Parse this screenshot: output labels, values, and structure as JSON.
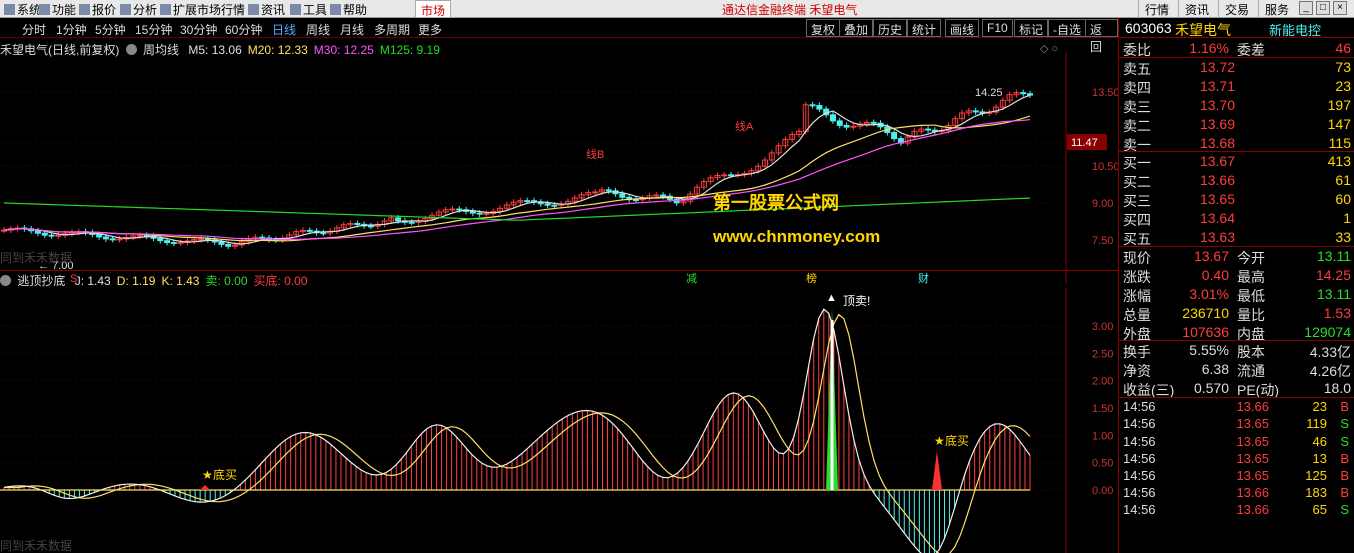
{
  "menu": {
    "items": [
      "系统",
      "功能",
      "报价",
      "分析",
      "扩展市场行情",
      "资讯",
      "工具",
      "帮助"
    ],
    "tab": "市场",
    "center_title": "通达信金融终端  禾望电气",
    "right_items": [
      "行情",
      "资讯",
      "交易",
      "服务"
    ]
  },
  "toolbar": {
    "periods": [
      "分时",
      "1分钟",
      "5分钟",
      "15分钟",
      "30分钟",
      "60分钟",
      "日线",
      "周线",
      "月线",
      "多周期",
      "更多"
    ],
    "active_period": "日线",
    "buttons": [
      "复权",
      "叠加",
      "历史",
      "统计",
      "画线",
      "F10",
      "标记",
      "-自选",
      "返回"
    ]
  },
  "main_chart": {
    "title": "禾望电气(日线,前复权)",
    "indicator_name": "周均线",
    "ma": [
      {
        "label": "M5: 13.06",
        "color": "#e0e0e0"
      },
      {
        "label": "M20: 12.33",
        "color": "#ffe066"
      },
      {
        "label": "M30: 12.25",
        "color": "#ff55ff"
      },
      {
        "label": "M125: 9.19",
        "color": "#22dd22"
      }
    ],
    "y_ticks": [
      "13.50",
      "11.47",
      "10.50",
      "9.00",
      "7.50"
    ],
    "current_price_box": "11.47",
    "high_label": "14.25",
    "low_label": "7.00",
    "annotations": [
      "线B",
      "线A"
    ],
    "event_markers": [
      "S",
      "减",
      "榜",
      "财"
    ],
    "watermark_left": "同到禾禾数据",
    "watermark_1": "第一股票公式网",
    "watermark_2": "www.chnmoney.com"
  },
  "sub_chart": {
    "name": "逃顶抄底",
    "values": [
      {
        "label": "J: 1.43",
        "color": "#e0e0e0"
      },
      {
        "label": "D: 1.19",
        "color": "#ffe066"
      },
      {
        "label": "K: 1.43",
        "color": "#ffe066"
      },
      {
        "label": "卖: 0.00",
        "color": "#2bdc2b"
      },
      {
        "label": "买底: 0.00",
        "color": "#ff3c3c"
      }
    ],
    "y_ticks": [
      "3.00",
      "2.50",
      "2.00",
      "1.50",
      "1.00",
      "0.50",
      "0.00"
    ],
    "signal_top": "顶卖!",
    "signal_bottom": "底买",
    "watermark": "同到禾禾数据"
  },
  "quote": {
    "code": "603063",
    "name": "禾望电气",
    "sector": "新能电控",
    "weibi_label": "委比",
    "weibi_value": "1.16%",
    "weicha_label": "委差",
    "weicha_value": "46",
    "asks": [
      {
        "label": "卖五",
        "price": "13.72",
        "vol": "73"
      },
      {
        "label": "卖四",
        "price": "13.71",
        "vol": "23"
      },
      {
        "label": "卖三",
        "price": "13.70",
        "vol": "197"
      },
      {
        "label": "卖二",
        "price": "13.69",
        "vol": "147"
      },
      {
        "label": "卖一",
        "price": "13.68",
        "vol": "115"
      }
    ],
    "bids": [
      {
        "label": "买一",
        "price": "13.67",
        "vol": "413"
      },
      {
        "label": "买二",
        "price": "13.66",
        "vol": "61"
      },
      {
        "label": "买三",
        "price": "13.65",
        "vol": "60"
      },
      {
        "label": "买四",
        "price": "13.64",
        "vol": "1"
      },
      {
        "label": "买五",
        "price": "13.63",
        "vol": "33"
      }
    ],
    "stats": [
      {
        "l1": "现价",
        "v1": "13.67",
        "c1": "red",
        "l2": "今开",
        "v2": "13.11",
        "c2": "green"
      },
      {
        "l1": "涨跌",
        "v1": "0.40",
        "c1": "red",
        "l2": "最高",
        "v2": "14.25",
        "c2": "red"
      },
      {
        "l1": "涨幅",
        "v1": "3.01%",
        "c1": "red",
        "l2": "最低",
        "v2": "13.11",
        "c2": "green"
      },
      {
        "l1": "总量",
        "v1": "236710",
        "c1": "yellow",
        "l2": "量比",
        "v2": "1.53",
        "c2": "red"
      },
      {
        "l1": "外盘",
        "v1": "107636",
        "c1": "red",
        "l2": "内盘",
        "v2": "129074",
        "c2": "green"
      }
    ],
    "stats2": [
      {
        "l1": "换手",
        "v1": "5.55%",
        "l2": "股本",
        "v2": "4.33亿"
      },
      {
        "l1": "净资",
        "v1": "6.38",
        "l2": "流通",
        "v2": "4.26亿"
      },
      {
        "l1": "收益(三)",
        "v1": "0.570",
        "l2": "PE(动)",
        "v2": "18.0"
      }
    ],
    "ticks": [
      {
        "time": "14:56",
        "price": "13.66",
        "vol": "23",
        "side": "B"
      },
      {
        "time": "14:56",
        "price": "13.65",
        "vol": "119",
        "side": "S"
      },
      {
        "time": "14:56",
        "price": "13.65",
        "vol": "46",
        "side": "S"
      },
      {
        "time": "14:56",
        "price": "13.65",
        "vol": "13",
        "side": "B"
      },
      {
        "time": "14:56",
        "price": "13.65",
        "vol": "125",
        "side": "B"
      },
      {
        "time": "14:56",
        "price": "13.66",
        "vol": "183",
        "side": "B"
      },
      {
        "time": "14:56",
        "price": "13.66",
        "vol": "65",
        "side": "S"
      }
    ]
  }
}
